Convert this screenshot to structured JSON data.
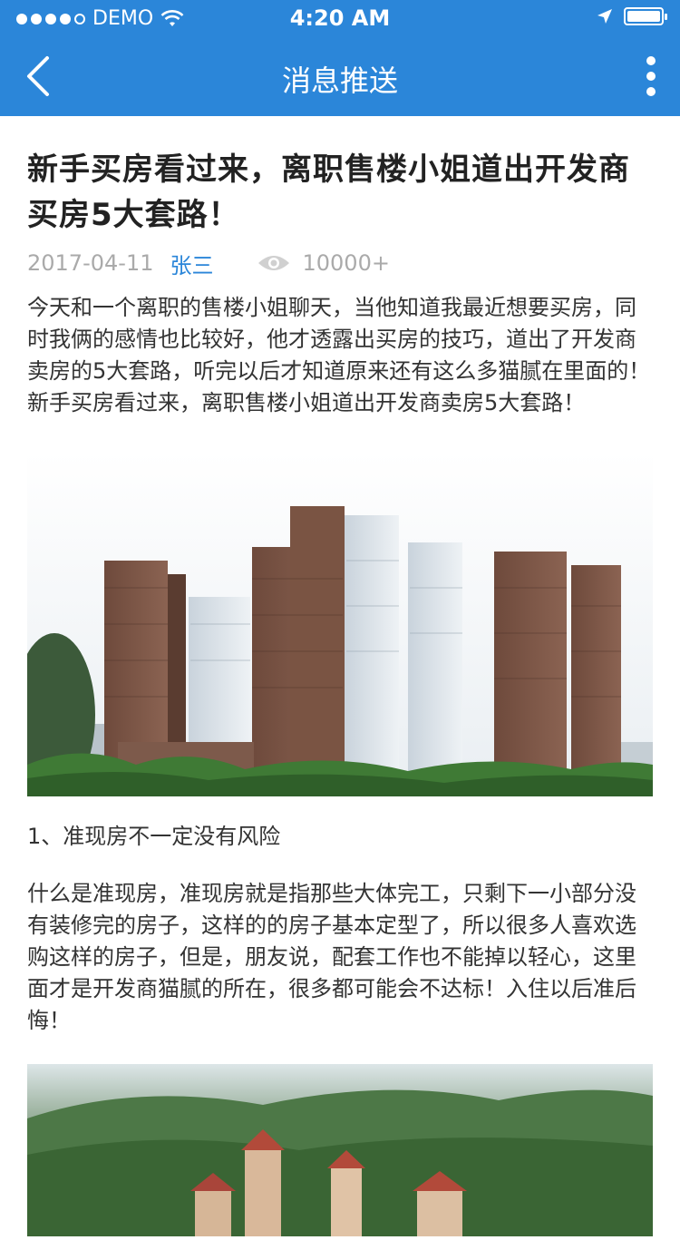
{
  "status": {
    "carrier": "DEMO",
    "time": "4:20 AM",
    "signal_dots": 5
  },
  "nav": {
    "title": "消息推送",
    "back_icon": "chevron-left-icon",
    "more_icon": "more-vertical-icon"
  },
  "article": {
    "title": "新手买房看过来，离职售楼小姐道出开发商买房5大套路！",
    "date": "2017-04-11",
    "author": "张三",
    "views": "10000+",
    "intro": "今天和一个离职的售楼小姐聊天，当他知道我最近想要买房，同时我俩的感情也比较好，他才透露出买房的技巧，道出了开发商卖房的5大套路，听完以后才知道原来还有这么多猫腻在里面的！新手买房看过来，离职售楼小姐道出开发商卖房5大套路！",
    "section1_heading": "1、准现房不一定没有风险",
    "section1_body": "什么是准现房，准现房就是指那些大体完工，只剩下一小部分没有装修完的房子，这样的的房子基本定型了，所以很多人喜欢选购这样的房子，但是，朋友说，配套工作也不能掉以轻心，这里面才是开发商猫腻的所在，很多都可能会不达标！入住以后准后悔！"
  },
  "colors": {
    "brand": "#2b86d9",
    "text": "#333333",
    "meta": "#aaaaaa"
  }
}
